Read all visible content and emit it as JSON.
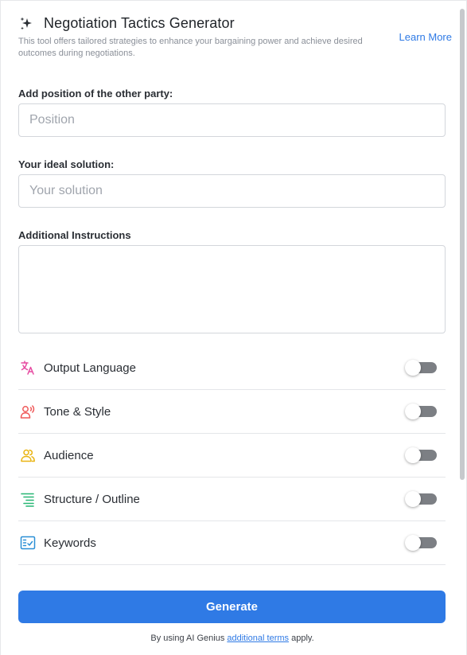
{
  "header": {
    "title": "Negotiation Tactics Generator",
    "subtitle": "This tool offers tailored strategies to enhance your bargaining power and achieve desired outcomes during negotiations.",
    "learn_more": "Learn More",
    "icon": "sparkle-icon"
  },
  "fields": {
    "position": {
      "label": "Add position of the other party:",
      "placeholder": "Position",
      "value": ""
    },
    "solution": {
      "label": "Your ideal solution:",
      "placeholder": "Your solution",
      "value": ""
    },
    "instructions": {
      "label": "Additional Instructions",
      "value": ""
    }
  },
  "options": [
    {
      "label": "Output Language",
      "icon": "translate-icon",
      "color": "#e64aa1",
      "enabled": false
    },
    {
      "label": "Tone & Style",
      "icon": "person-voice-icon",
      "color": "#ef5a5a",
      "enabled": false
    },
    {
      "label": "Audience",
      "icon": "people-icon",
      "color": "#e9b412",
      "enabled": false
    },
    {
      "label": "Structure / Outline",
      "icon": "outline-list-icon",
      "color": "#27b673",
      "enabled": false
    },
    {
      "label": "Keywords",
      "icon": "keywords-checklist-icon",
      "color": "#2a8fd6",
      "enabled": false
    }
  ],
  "actions": {
    "generate_label": "Generate"
  },
  "footer": {
    "prefix": "By using AI Genius ",
    "link": "additional terms",
    "suffix": " apply."
  },
  "colors": {
    "accent": "#2f7ae5",
    "toggle_off": "#7c7f84",
    "border": "#d3d6db"
  }
}
